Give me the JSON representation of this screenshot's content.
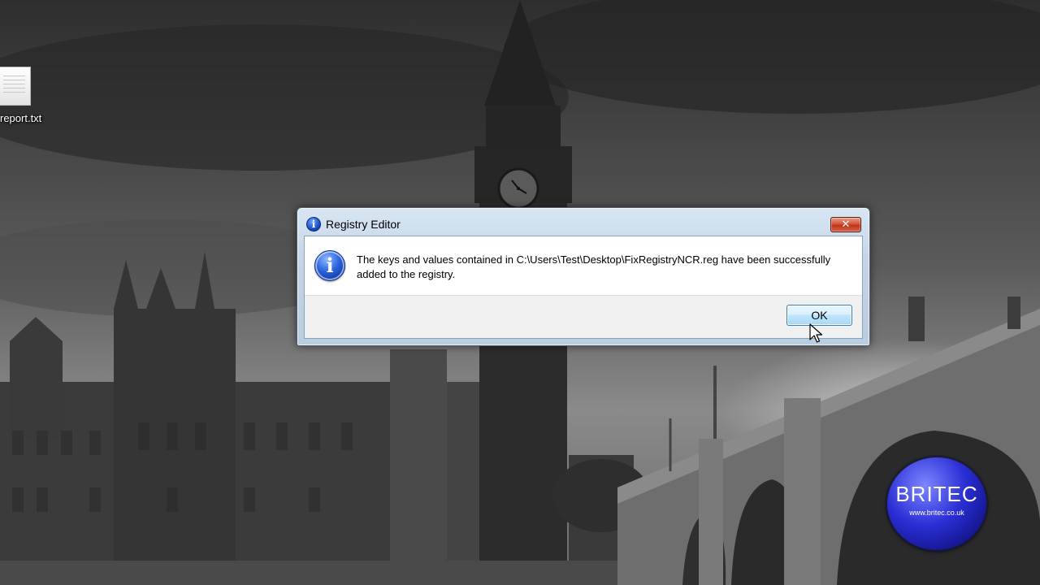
{
  "desktop": {
    "icons": [
      {
        "label": "report.txt",
        "icon": "text-file-icon"
      }
    ]
  },
  "dialog": {
    "title": "Registry Editor",
    "title_icon": "info-icon",
    "close_glyph": "✕",
    "message_icon": "info-icon",
    "message": "The keys and values contained in C:\\Users\\Test\\Desktop\\FixRegistryNCR.reg have been successfully added to the registry.",
    "ok_label": "OK"
  },
  "watermark": {
    "word": "BRITEC",
    "url": "www.britec.co.uk"
  }
}
